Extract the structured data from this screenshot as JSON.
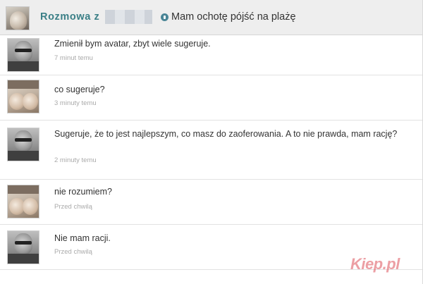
{
  "header": {
    "title": "Rozmowa z",
    "status_text": "Mam ochotę pójść na plażę"
  },
  "messages": [
    {
      "author": "man",
      "text": "Zmienił bym avatar, zbyt wiele sugeruje.",
      "time": "7 minut temu"
    },
    {
      "author": "woman",
      "text": "co sugeruje?",
      "time": "3 minuty temu"
    },
    {
      "author": "man",
      "text": "Sugeruje, że to jest najlepszym, co masz do zaoferowania. A to nie prawda, mam rację?",
      "time": "2 minuty temu"
    },
    {
      "author": "woman",
      "text": "nie rozumiem?",
      "time": "Przed chwilą"
    },
    {
      "author": "man",
      "text": "Nie mam racji.",
      "time": "Przed chwilą"
    }
  ],
  "watermark": "Kiep.pl",
  "colors": {
    "header_bg": "#eeeeee",
    "title": "#3a7f86",
    "text": "#333333",
    "time": "#aaaaaa"
  }
}
